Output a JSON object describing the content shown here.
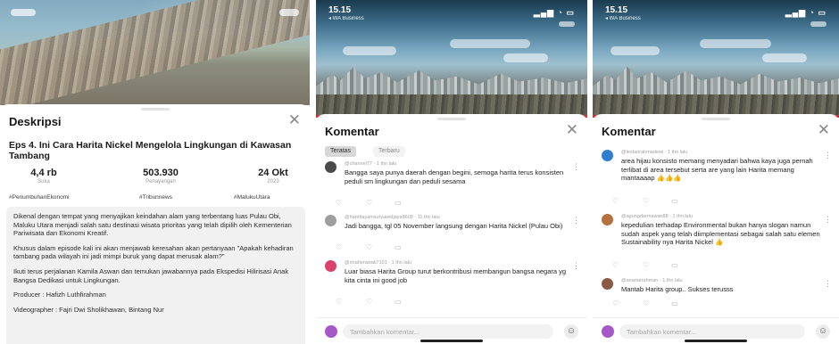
{
  "description_panel": {
    "title": "Deskripsi",
    "close": "✕",
    "episode_title": "Eps 4. Ini Cara Harita Nickel Mengelola Lingkungan di Kawasan Tambang",
    "stats": [
      {
        "value": "4,4 rb",
        "label": "Suka"
      },
      {
        "value": "503.930",
        "label": "Penayangan"
      },
      {
        "value": "24 Okt",
        "label": "2023"
      }
    ],
    "tags": [
      "#PenumbuhanEkonomi",
      "#Tribunnews",
      "#MalukuUtara"
    ],
    "paragraphs": [
      "Dikenal dengan tempat yang menyajikan keindahan alam yang terbentang luas Pulau Obi, Maluku Utara menjadi salah satu destinasi wisata prioritas yang telah dipilih oleh Kementerian Pariwisata dan Ekonomi Kreatif.",
      "Khusus dalam episode kali ini akan menjawab keresahan akan pertanyaan \"Apakah kehadiran tambang pada wilayah ini jadi mimpi buruk yang dapat merusak alam?\"",
      "Ikuti terus perjalanan Kamila Aswan dan temukan jawabannya pada Ekspedisi Hilirisasi Anak Bangsa Dedikasi untuk Lingkungan.",
      "Producer : Hafizh Luthfirahman",
      "Videographer : Fajri Dwi Sholikhawan, Bintang Nur"
    ]
  },
  "comments_panel_1": {
    "status_time": "15.15",
    "status_sub": "◂ WA Business",
    "title": "Komentar",
    "close": "✕",
    "tabs": [
      "Teratas",
      "Terbaru"
    ],
    "comments": [
      {
        "user": "@channel77 · 1 thn lalu",
        "text": "Bangga saya punya daerah dengan begini, semoga harita terus konsisten peduli sm lingkungan dan peduli sesama"
      },
      {
        "user": "@harditayamsuryawidjaya8608 · 11 thn lalu",
        "text": "Jadi bangga, tgl 05 November langsung dengan Harita Nickel (Pulau Obi)"
      },
      {
        "user": "@rinaherawati7101 · 1 thn lalu",
        "text": "Luar biasa Harita Group turut berkontribusi membangun bangsa negara yg kita cinta ini good job"
      }
    ],
    "input_placeholder": "Tambahkan komentar..."
  },
  "comments_panel_2": {
    "status_time": "15.15",
    "status_sub": "◂ WA Business",
    "title": "Komentar",
    "close": "✕",
    "comments": [
      {
        "user": "@lestarirahmadewi · 1 thn lalu",
        "text": "area hijau konsisto memang menyadari bahwa kaya juga pernah terlibat di area tersebut serta are yang lain Harita memang mantaaaap 👍👍👍"
      },
      {
        "user": "@agungdarmawan88 · 1 thn lalu",
        "text": "kepedulian terhadap Environmental bukan hanya slogan namun sudah aspek yang telah diimplementasi sebagai salah satu elemen Sustainability nya Harita Nickel 👍"
      },
      {
        "user": "@ananarrahman · 1 thn lalu",
        "text": "Mantab Harita group.. Sukses terusss"
      }
    ],
    "input_placeholder": "Tambahkan komentar..."
  },
  "action_icons": {
    "like": "♡",
    "dislike": "♡",
    "reply": "▭"
  },
  "colors": {
    "accent_red": "#c63a3a",
    "avatar_purple": "#a658c8"
  }
}
